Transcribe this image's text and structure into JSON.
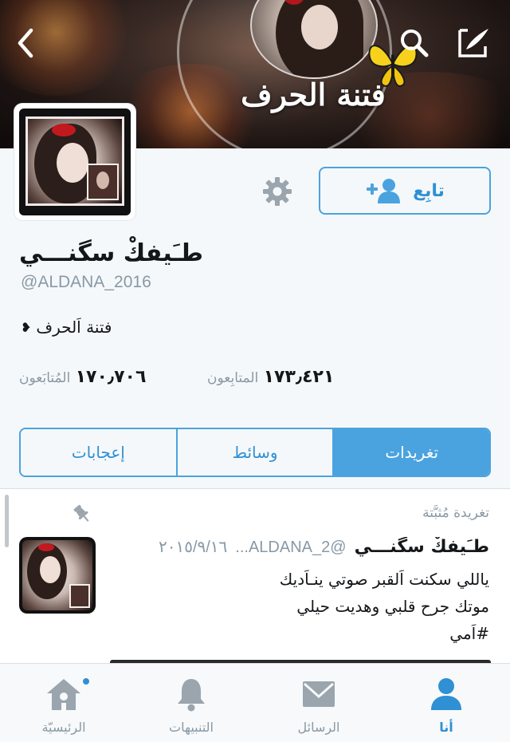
{
  "header": {
    "banner_caption": "فتنة الحرف",
    "back_icon": "chevron-left-icon",
    "search_icon": "search-icon",
    "compose_icon": "compose-icon"
  },
  "profile": {
    "display_name": "طـَيفكْ سگنـــي",
    "handle": "@ALDANA_2016",
    "bio": "فتنة اَلحرف",
    "bio_heart": "❥",
    "follow_label": "تابِع",
    "settings_icon": "gear-icon",
    "following_count": "١٧٣٫٤٢١",
    "following_label": "المتابِعون",
    "followers_count": "١٧٠٫٧٠٦",
    "followers_label": "المُتابَعون"
  },
  "tabs": [
    {
      "label": "تغريدات",
      "active": true
    },
    {
      "label": "وسائط",
      "active": false
    },
    {
      "label": "إعجابات",
      "active": false
    }
  ],
  "pinned_tweet": {
    "pin_label": "تغريدة مُثبَّتة",
    "name": "طـَيفكْ سگنـــي",
    "handle": "@ALDANA_2...",
    "date": "٢٠١٥/٩/١٦",
    "lines": [
      "ياللي سكنت اَلقبر صوتي ينـاَديك",
      "موتك جرح قلبي وهديت حيلي",
      "#اَمي"
    ]
  },
  "bottom_nav": [
    {
      "label": "الرئيسيّة",
      "icon": "home-icon",
      "active": false,
      "has_dot": true
    },
    {
      "label": "التنبيهات",
      "icon": "bell-icon",
      "active": false,
      "has_dot": false
    },
    {
      "label": "الرسائل",
      "icon": "envelope-icon",
      "active": false,
      "has_dot": false
    },
    {
      "label": "أنا",
      "icon": "person-icon",
      "active": true,
      "has_dot": false
    }
  ],
  "colors": {
    "accent": "#4aa3df",
    "accent_dark": "#2f90d4",
    "muted": "#8899a6",
    "text": "#14171a",
    "background": "#f5f8fa"
  }
}
